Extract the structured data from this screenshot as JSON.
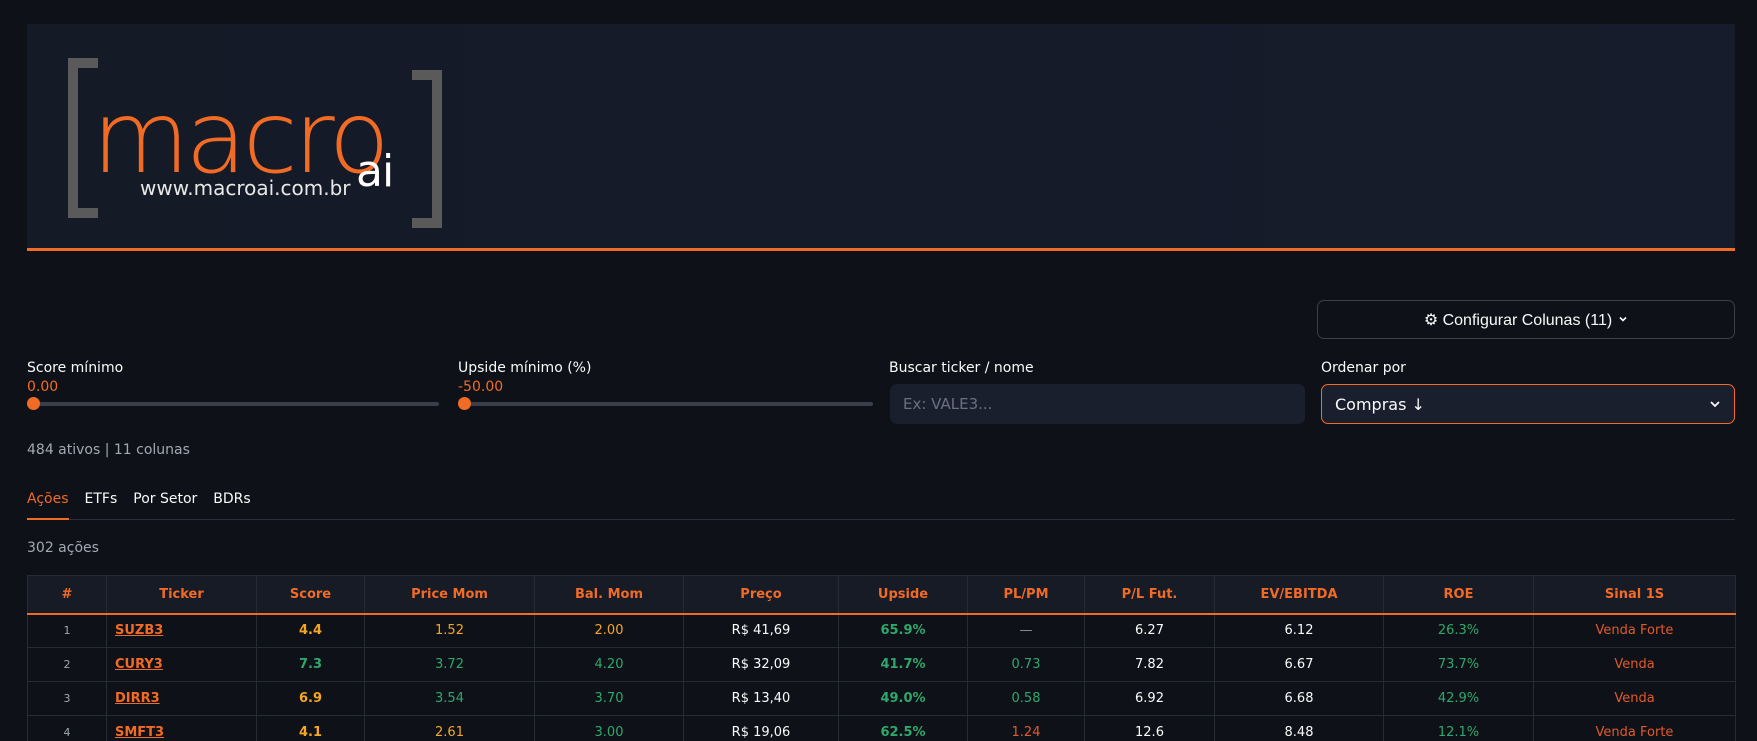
{
  "logo": {
    "word": "macro",
    "suffix": "ai",
    "url": "www.macroai.com.br"
  },
  "config_button": {
    "icon": "gear-icon",
    "label": "⚙ Configurar Colunas (11)",
    "chevron": "chevron-down-icon"
  },
  "filters": {
    "score": {
      "label": "Score mínimo",
      "value": "0.00",
      "level": 0
    },
    "upside": {
      "label": "Upside mínimo (%)",
      "value": "-50.00",
      "level": 0
    },
    "search": {
      "label": "Buscar ticker / nome",
      "placeholder": "Ex: VALE3..."
    },
    "sort": {
      "label": "Ordenar por",
      "value": "Compras ↓"
    }
  },
  "summary": "484 ativos | 11 colunas",
  "tabs": [
    {
      "label": "Ações",
      "active": true
    },
    {
      "label": "ETFs",
      "active": false
    },
    {
      "label": "Por Setor",
      "active": false
    },
    {
      "label": "BDRs",
      "active": false
    }
  ],
  "sub_count": "302 ações",
  "table": {
    "headers": [
      "#",
      "Ticker",
      "Score",
      "Price Mom",
      "Bal. Mom",
      "Preço",
      "Upside",
      "PL/PM",
      "P/L Fut.",
      "EV/EBITDA",
      "ROE",
      "Sinal 1S"
    ],
    "rows": [
      [
        "1",
        "SUZB3",
        "4.4",
        "1.52",
        "2.00",
        "R$ 41,69",
        "65.9%",
        "—",
        "6.27",
        "6.12",
        "26.3%",
        "Venda Forte"
      ],
      [
        "2",
        "CURY3",
        "7.3",
        "3.72",
        "4.20",
        "R$ 32,09",
        "41.7%",
        "0.73",
        "7.82",
        "6.67",
        "73.7%",
        "Venda"
      ],
      [
        "3",
        "DIRR3",
        "6.9",
        "3.54",
        "3.70",
        "R$ 13,40",
        "49.0%",
        "0.58",
        "6.92",
        "6.68",
        "42.9%",
        "Venda"
      ],
      [
        "4",
        "SMFT3",
        "4.1",
        "2.61",
        "3.00",
        "R$ 19,06",
        "62.5%",
        "1.24",
        "12.6",
        "8.48",
        "12.1%",
        "Venda Forte"
      ]
    ]
  },
  "colors": {
    "accent": "#f26b25",
    "amber": "#f5a623",
    "green": "#2ea86a",
    "red": "#e05a2b"
  }
}
